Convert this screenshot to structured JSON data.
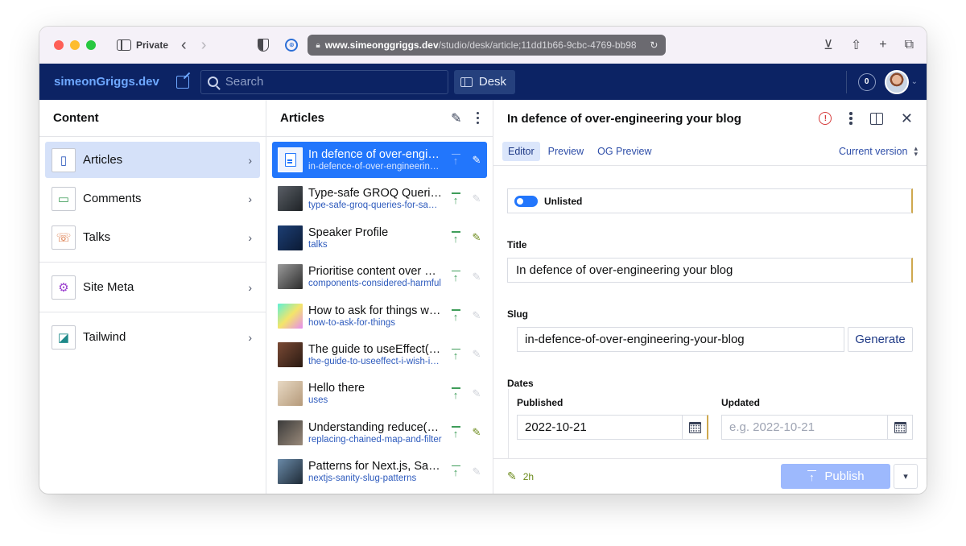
{
  "browser": {
    "private_label": "Private",
    "url_host": "www.simeonggriggs.dev",
    "url_path": "/studio/desk/article;11dd1b66-9cbc-4769-bb98"
  },
  "navbar": {
    "brand": "simeonGriggs.dev",
    "search_placeholder": "Search",
    "desk_label": "Desk",
    "notification_count": "0"
  },
  "content_pane": {
    "title": "Content",
    "items": [
      {
        "label": "Articles",
        "icon": "document-icon",
        "selected": true
      },
      {
        "label": "Comments",
        "icon": "comment-icon"
      },
      {
        "label": "Talks",
        "icon": "phone-icon"
      },
      {
        "label": "Site Meta",
        "icon": "cog-icon"
      },
      {
        "label": "Tailwind",
        "icon": "image-icon"
      }
    ]
  },
  "articles_pane": {
    "title": "Articles",
    "items": [
      {
        "title": "In defence of over-engineering your blog",
        "slug": "in-defence-of-over-engineering-your-blog",
        "thumb": "doc",
        "edited": true
      },
      {
        "title": "Type-safe GROQ Queries for Sanity",
        "slug": "type-safe-groq-queries-for-sanity",
        "thumb": "#5a5f66,#1e2226",
        "edited": false
      },
      {
        "title": "Speaker Profile",
        "slug": "talks",
        "thumb": "#1d3f74,#0b1a35",
        "edited": true
      },
      {
        "title": "Prioritise content over components",
        "slug": "components-considered-harmful",
        "thumb": "#9a9a9a,#2c2c2c",
        "edited": false
      },
      {
        "title": "How to ask for things without asking",
        "slug": "how-to-ask-for-things",
        "thumb": "#5ef0d6,#f4e56a,#e68cf0",
        "edited": false
      },
      {
        "title": "The guide to useEffect() I wish I had",
        "slug": "the-guide-to-useeffect-i-wish-i-had",
        "thumb": "#7a4a35,#2a1a12",
        "edited": false
      },
      {
        "title": "Hello there",
        "slug": "uses",
        "thumb": "#e8d9c4,#b59a7a",
        "edited": false
      },
      {
        "title": "Understanding reduce() in JavaScript",
        "slug": "replacing-chained-map-and-filter",
        "thumb": "#3a3a3a,#9a8a7a",
        "edited": true
      },
      {
        "title": "Patterns for Next.js, Sanity and slugs",
        "slug": "nextjs-sanity-slug-patterns",
        "thumb": "#6a8aa8,#1e2a36",
        "edited": false
      }
    ]
  },
  "document": {
    "title": "In defence of over-engineering your blog",
    "tabs": [
      "Editor",
      "Preview",
      "OG Preview"
    ],
    "active_tab": "Editor",
    "version_label": "Current version",
    "unlisted_label": "Unlisted",
    "title_label": "Title",
    "title_value": "In defence of over-engineering your blog",
    "slug_label": "Slug",
    "slug_value": "in-defence-of-over-engineering-your-blog",
    "generate_label": "Generate",
    "dates_label": "Dates",
    "published_label": "Published",
    "published_value": "2022-10-21",
    "updated_label": "Updated",
    "updated_placeholder": "e.g. 2022-10-21",
    "edited_ago": "2h",
    "publish_label": "Publish"
  },
  "colors": {
    "navbar": "#0c2364",
    "accent": "#2276fc",
    "published_green": "#3f9d5a",
    "changed_amber": "#cfa84e"
  }
}
